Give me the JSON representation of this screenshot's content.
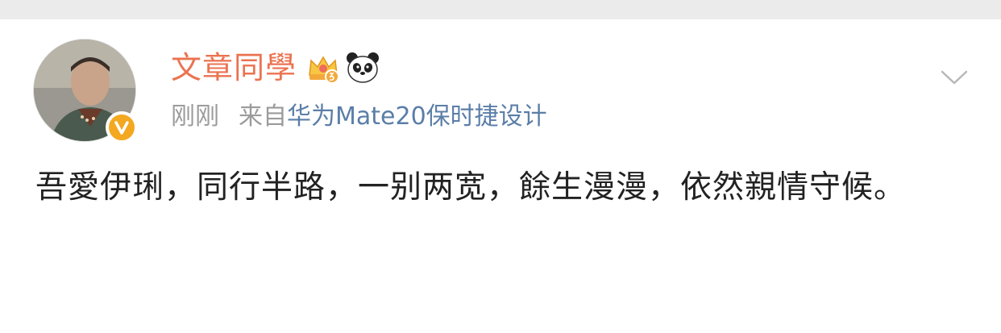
{
  "post": {
    "username": "文章同學",
    "time": "刚刚",
    "source_prefix": "来自",
    "device": "华为Mate20保时捷设计",
    "content": "吾愛伊琍，同行半路，一别两宽，餘生漫漫，依然親情守候。",
    "icons": {
      "avatar": "user-avatar",
      "verified": "verified-badge-icon",
      "vip": "vip-crown-icon",
      "panda": "panda-icon",
      "menu": "chevron-down-icon"
    }
  },
  "colors": {
    "username": "#eb7350",
    "meta": "#9b9b9b",
    "device_link": "#5b7ea8",
    "content": "#222222",
    "verified": "#f4a820",
    "topbar": "#ebebeb"
  }
}
